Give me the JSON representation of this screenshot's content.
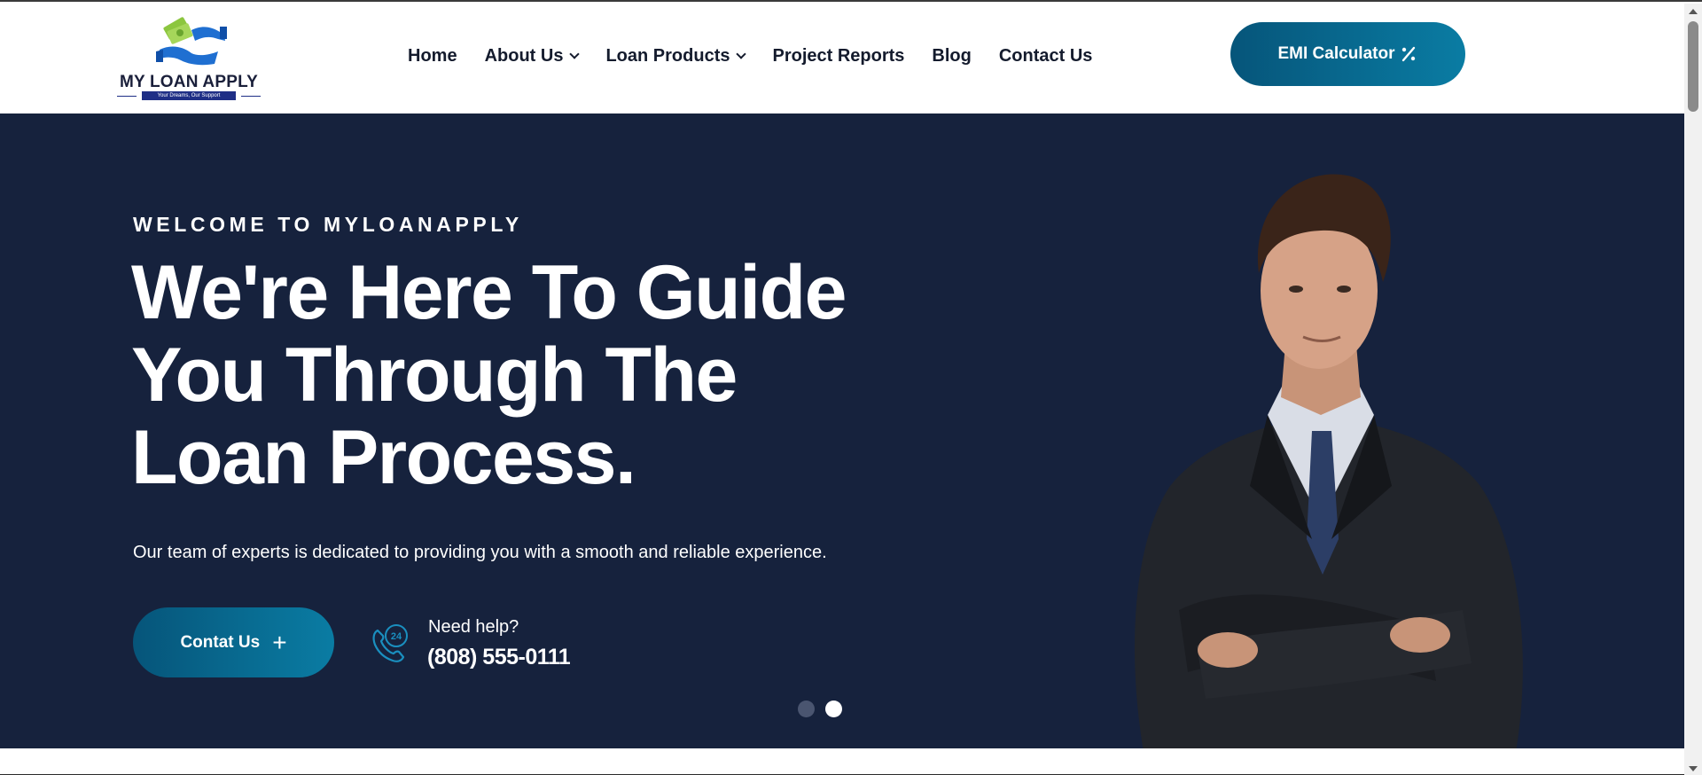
{
  "header": {
    "logo": {
      "name": "MY LOAN APPLY",
      "tagline": "Your Dreams, Our Support"
    },
    "nav": [
      {
        "label": "Home",
        "has_dropdown": false
      },
      {
        "label": "About Us",
        "has_dropdown": true
      },
      {
        "label": "Loan Products",
        "has_dropdown": true
      },
      {
        "label": "Project Reports",
        "has_dropdown": false
      },
      {
        "label": "Blog",
        "has_dropdown": false
      },
      {
        "label": "Contact Us",
        "has_dropdown": false
      }
    ],
    "emi_button": {
      "label": "EMI Calculator",
      "icon": "percent-icon"
    }
  },
  "hero": {
    "eyebrow": "WELCOME TO MYLOANAPPLY",
    "headline": "We're Here To Guide You Through The Loan Process.",
    "subtext": "Our team of experts is dedicated to providing you with a smooth and reliable experience.",
    "contact_button": {
      "label": "Contat Us",
      "icon": "plus-icon"
    },
    "help": {
      "label": "Need help?",
      "phone": "(808) 555-0111",
      "icon": "phone-24-icon"
    },
    "slider": {
      "slide_count": 2,
      "active_index": 1
    }
  },
  "colors": {
    "hero_bg": "#16223d",
    "button_gradient_start": "#06557a",
    "button_gradient_end": "#0a7ca3",
    "nav_text": "#141b2d",
    "logo_green": "#8cc63f",
    "logo_blue": "#1f6fd1"
  }
}
